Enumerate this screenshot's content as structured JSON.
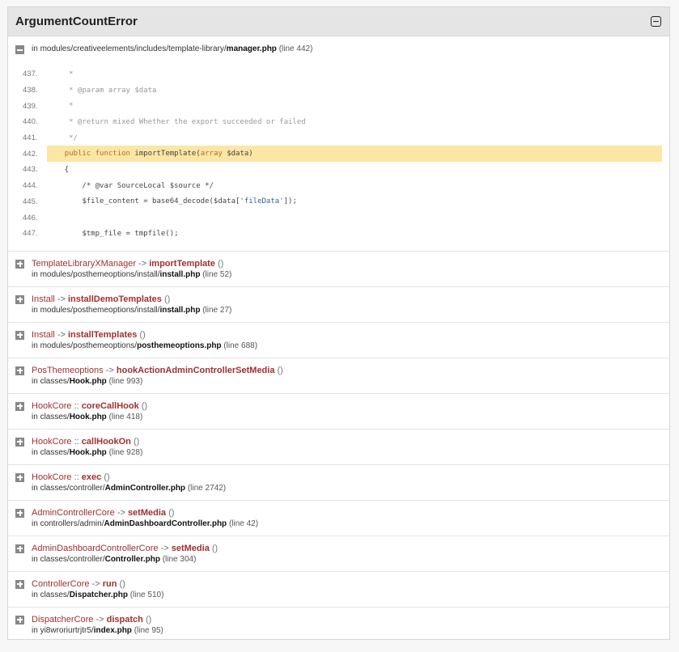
{
  "error_title": "ArgumentCountError",
  "main_frame": {
    "prefix": "in ",
    "path": "modules/creativeelements/includes/template-library/",
    "file": "manager.php",
    "line": "(line 442)",
    "code": [
      {
        "num": "437.",
        "text": "     *"
      },
      {
        "num": "438.",
        "text": "     * @param array $data"
      },
      {
        "num": "439.",
        "text": "     *"
      },
      {
        "num": "440.",
        "text": "     * @return mixed Whether the export succeeded or failed"
      },
      {
        "num": "441.",
        "text": "     */"
      },
      {
        "num": "442.",
        "text": "    public function importTemplate(array $data)"
      },
      {
        "num": "443.",
        "text": "    {"
      },
      {
        "num": "444.",
        "text": "        /* @var SourceLocal $source */"
      },
      {
        "num": "445.",
        "text": "        $file_content = base64_decode($data['fileData']);"
      },
      {
        "num": "446.",
        "text": ""
      },
      {
        "num": "447.",
        "text": "        $tmp_file = tmpfile();"
      }
    ]
  },
  "frames": [
    {
      "class": "TemplateLibraryXManager",
      "sep": "->",
      "method": "importTemplate",
      "parens": "()",
      "path": "modules/posthemeoptions/install/",
      "file": "install.php",
      "line": "(line 52)"
    },
    {
      "class": "Install",
      "sep": "->",
      "method": "installDemoTemplates",
      "parens": "()",
      "path": "modules/posthemeoptions/install/",
      "file": "install.php",
      "line": "(line 27)"
    },
    {
      "class": "Install",
      "sep": "->",
      "method": "installTemplates",
      "parens": "()",
      "path": "modules/posthemeoptions/",
      "file": "posthemeoptions.php",
      "line": "(line 688)"
    },
    {
      "class": "PosThemeoptions",
      "sep": "->",
      "method": "hookActionAdminControllerSetMedia",
      "parens": "()",
      "path": "classes/",
      "file": "Hook.php",
      "line": "(line 993)"
    },
    {
      "class": "HookCore",
      "sep": "::",
      "method": "coreCallHook",
      "parens": "()",
      "path": "classes/",
      "file": "Hook.php",
      "line": "(line 418)"
    },
    {
      "class": "HookCore",
      "sep": "::",
      "method": "callHookOn",
      "parens": "()",
      "path": "classes/",
      "file": "Hook.php",
      "line": "(line 928)"
    },
    {
      "class": "HookCore",
      "sep": "::",
      "method": "exec",
      "parens": "()",
      "path": "classes/controller/",
      "file": "AdminController.php",
      "line": "(line 2742)"
    },
    {
      "class": "AdminControllerCore",
      "sep": "->",
      "method": "setMedia",
      "parens": "()",
      "path": "controllers/admin/",
      "file": "AdminDashboardController.php",
      "line": "(line 42)"
    },
    {
      "class": "AdminDashboardControllerCore",
      "sep": "->",
      "method": "setMedia",
      "parens": "()",
      "path": "classes/controller/",
      "file": "Controller.php",
      "line": "(line 304)"
    },
    {
      "class": "ControllerCore",
      "sep": "->",
      "method": "run",
      "parens": "()",
      "path": "classes/",
      "file": "Dispatcher.php",
      "line": "(line 510)"
    },
    {
      "class": "DispatcherCore",
      "sep": "->",
      "method": "dispatch",
      "parens": "()",
      "path": "yi8wroriurtrjtr5/",
      "file": "index.php",
      "line": "(line 95)"
    }
  ],
  "loc_prefix": "in "
}
